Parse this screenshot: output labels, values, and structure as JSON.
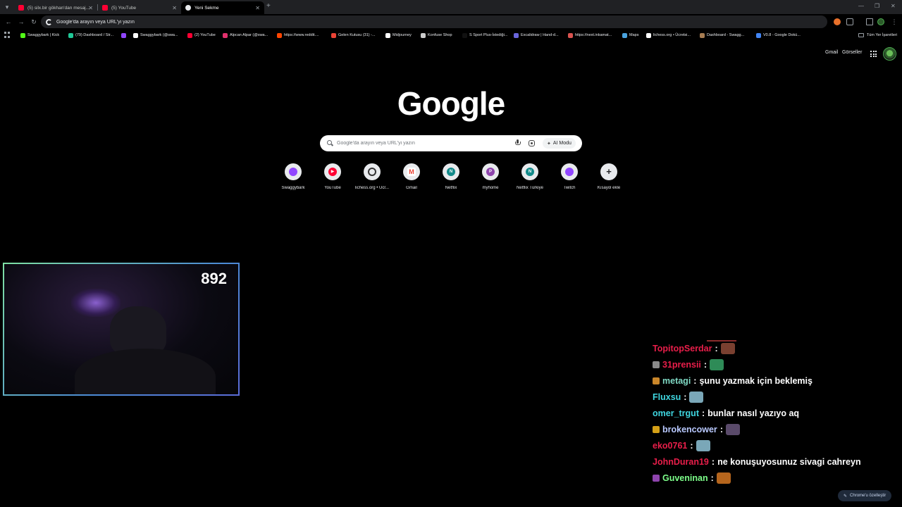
{
  "tabs": [
    {
      "title": "(5) silx.bir gökhan'dan mesaj...",
      "icon": "youtube-icon",
      "active": false
    },
    {
      "title": "(5) YouTube",
      "icon": "youtube-icon",
      "active": false
    },
    {
      "title": "Yeni Sekme",
      "icon": "chrome-icon",
      "active": true
    }
  ],
  "omnibox": {
    "placeholder": "Google'da arayın veya URL'yi yazın"
  },
  "bookmarks": [
    {
      "label": "Swaggybark | Kick",
      "color": "#53fc18"
    },
    {
      "label": "(79) Dashboard / Str...",
      "color": "#20c997"
    },
    {
      "label": "",
      "color": "#9146ff"
    },
    {
      "label": "Swaggybark (@swa...",
      "color": "#ffffff"
    },
    {
      "label": "(2) YouTube",
      "color": "#ff0033"
    },
    {
      "label": "Alpcan Alpar (@swa...",
      "color": "#e1306c"
    },
    {
      "label": "https://www.reddit....",
      "color": "#ff4500"
    },
    {
      "label": "Gelen Kutusu (31) -...",
      "color": "#ea4335"
    },
    {
      "label": "Midjourney",
      "color": "#ffffff"
    },
    {
      "label": "Konfuse Shop",
      "color": "#cccccc"
    },
    {
      "label": "S Sport Plus-İstediği...",
      "color": "#111111"
    },
    {
      "label": "Excalidraw | Hand-d...",
      "color": "#6965db"
    },
    {
      "label": "https://next.inkamat...",
      "color": "#d9534f"
    },
    {
      "label": "Maps",
      "color": "#4aa3df"
    },
    {
      "label": "lichess.org • Ücretsi...",
      "color": "#ffffff"
    },
    {
      "label": "Dashboard - Swagg...",
      "color": "#a67c52"
    },
    {
      "label": "V0.8 - Google Dokü...",
      "color": "#4285f4"
    }
  ],
  "bookmarks_all": "Tüm Yer İşaretleri",
  "google_links": {
    "gmail": "Gmail",
    "images": "Görseller"
  },
  "logo": "Google",
  "search": {
    "placeholder": "Google'da arayın veya URL'yi yazın",
    "ai_mode": "AI Modu"
  },
  "shortcuts": [
    {
      "label": "Swaggybark",
      "icon": "twitch-icon",
      "color": "#9146ff",
      "glyph": ""
    },
    {
      "label": "YouTube",
      "icon": "youtube-icon",
      "color": "#ff0033",
      "glyph": "▶"
    },
    {
      "label": "lichess.org • Ücr...",
      "icon": "lichess-icon",
      "color": "#333333",
      "glyph": ""
    },
    {
      "label": "Gmail",
      "icon": "gmail-icon",
      "color": "#ea4335",
      "glyph": "M"
    },
    {
      "label": "Netflix",
      "icon": "netflix-icon",
      "color": "#138a8a",
      "glyph": "N"
    },
    {
      "label": "myhome",
      "icon": "myhome-icon",
      "color": "#8e44ad",
      "glyph": "P"
    },
    {
      "label": "Netflix Türkiye",
      "icon": "netflix-icon",
      "color": "#138a8a",
      "glyph": "N"
    },
    {
      "label": "Twitch",
      "icon": "twitch-icon",
      "color": "#9146ff",
      "glyph": ""
    },
    {
      "label": "Kısayol ekle",
      "icon": "plus-icon",
      "color": "#e8eaed",
      "glyph": "+"
    }
  ],
  "webcam": {
    "counter": "892"
  },
  "chat": [
    {
      "user": "TopitopSerdar",
      "user_color": "#e91e4a",
      "badge": false,
      "badge_color": "",
      "message": "",
      "emote": true,
      "emote_color": "#7a4030"
    },
    {
      "user": "31prensii",
      "user_color": "#e91e4a",
      "badge": true,
      "badge_color": "#8a8a8a",
      "message": "",
      "emote": true,
      "emote_color": "#2e8b57"
    },
    {
      "user": "metagi",
      "user_color": "#7fd9c4",
      "badge": true,
      "badge_color": "#c9862a",
      "message": "şunu yazmak için beklemiş",
      "emote": false,
      "emote_color": ""
    },
    {
      "user": "Fluxsu",
      "user_color": "#3fd6e0",
      "badge": false,
      "badge_color": "",
      "message": "",
      "emote": true,
      "emote_color": "#7aa7b8"
    },
    {
      "user": "omer_trgut",
      "user_color": "#3fd6e0",
      "badge": false,
      "badge_color": "",
      "message": "bunlar nasıl yazıyo aq",
      "emote": false,
      "emote_color": ""
    },
    {
      "user": "brokencower",
      "user_color": "#b9c9ff",
      "badge": true,
      "badge_color": "#d4a017",
      "message": "",
      "emote": true,
      "emote_color": "#5a4a6a"
    },
    {
      "user": "eko0761",
      "user_color": "#e91e4a",
      "badge": false,
      "badge_color": "",
      "message": "",
      "emote": true,
      "emote_color": "#7aa7b8"
    },
    {
      "user": "JohnDuran19",
      "user_color": "#e91e4a",
      "badge": false,
      "badge_color": "",
      "message": "ne konuşuyosunuz sivagi cahreyn",
      "emote": false,
      "emote_color": ""
    },
    {
      "user": "Guveninan",
      "user_color": "#7dff8a",
      "badge": true,
      "badge_color": "#8e44ad",
      "message": "",
      "emote": true,
      "emote_color": "#b5651d"
    }
  ],
  "customize": "Chrome'u özelleştir"
}
